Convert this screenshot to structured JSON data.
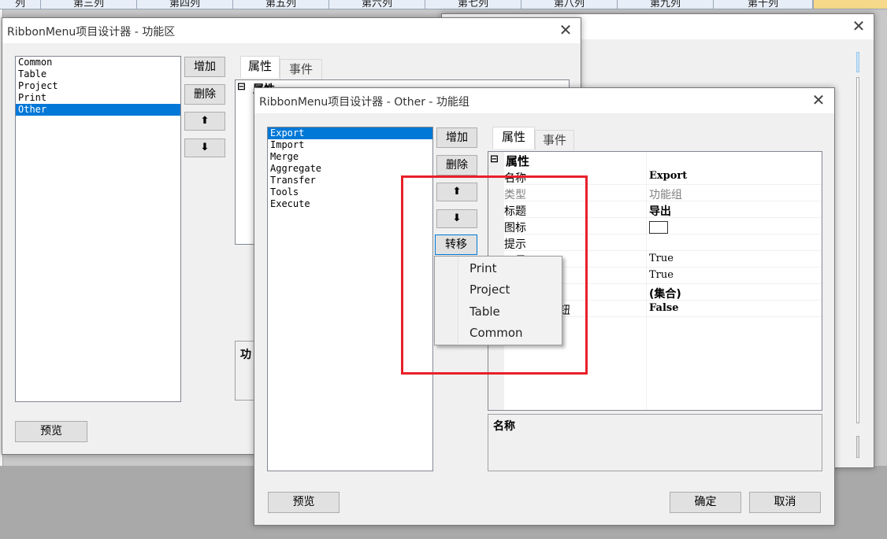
{
  "background": {
    "grid_columns": [
      "列",
      "第三列",
      "第四列",
      "第五列",
      "第六列",
      "第七列",
      "第八列",
      "第九列",
      "第十列"
    ]
  },
  "win1": {
    "title": "RibbonMenu项目设计器 - 功能区",
    "close": "✕",
    "list_items": [
      "Common",
      "Table",
      "Project",
      "Print",
      "Other"
    ],
    "selected_index": 4,
    "add_label": "增加",
    "delete_label": "删除",
    "up_label": "⬆",
    "down_label": "⬇",
    "tab_props": "属性",
    "tab_events": "事件",
    "prop_section": "属性",
    "desc_label": "功",
    "preview_label": "预览"
  },
  "win_back": {
    "close": "✕"
  },
  "win2": {
    "title": "RibbonMenu项目设计器 - Other - 功能组",
    "close": "✕",
    "list_items": [
      "Export",
      "Import",
      "Merge",
      "Aggregate",
      "Transfer",
      "Tools",
      "Execute"
    ],
    "selected_index": 0,
    "add_label": "增加",
    "delete_label": "删除",
    "up_label": "⬆",
    "down_label": "⬇",
    "transfer_label": "转移",
    "tab_props": "属性",
    "tab_events": "事件",
    "prop_section": "属性",
    "props": [
      {
        "name": "名称",
        "value": "Export",
        "bold": true
      },
      {
        "name": "类型",
        "value": "功能组",
        "gray": true
      },
      {
        "name": "标题",
        "value": "导出",
        "bold": true
      },
      {
        "name": "图标",
        "value": ""
      },
      {
        "name": "提示",
        "value": ""
      },
      {
        "name": "可见",
        "value": "True"
      },
      {
        "name": "",
        "value": "True"
      },
      {
        "name": "",
        "value": "(集合)",
        "bold": true
      },
      {
        "name": "钮",
        "value": "False",
        "bold": true
      }
    ],
    "desc_title": "名称",
    "preview_label": "预览",
    "ok_label": "确定",
    "cancel_label": "取消"
  },
  "context_menu": {
    "items": [
      "Print",
      "Project",
      "Table",
      "Common"
    ]
  },
  "colors": {
    "selection": "#0078d7",
    "highlight_box": "#e8202a"
  }
}
